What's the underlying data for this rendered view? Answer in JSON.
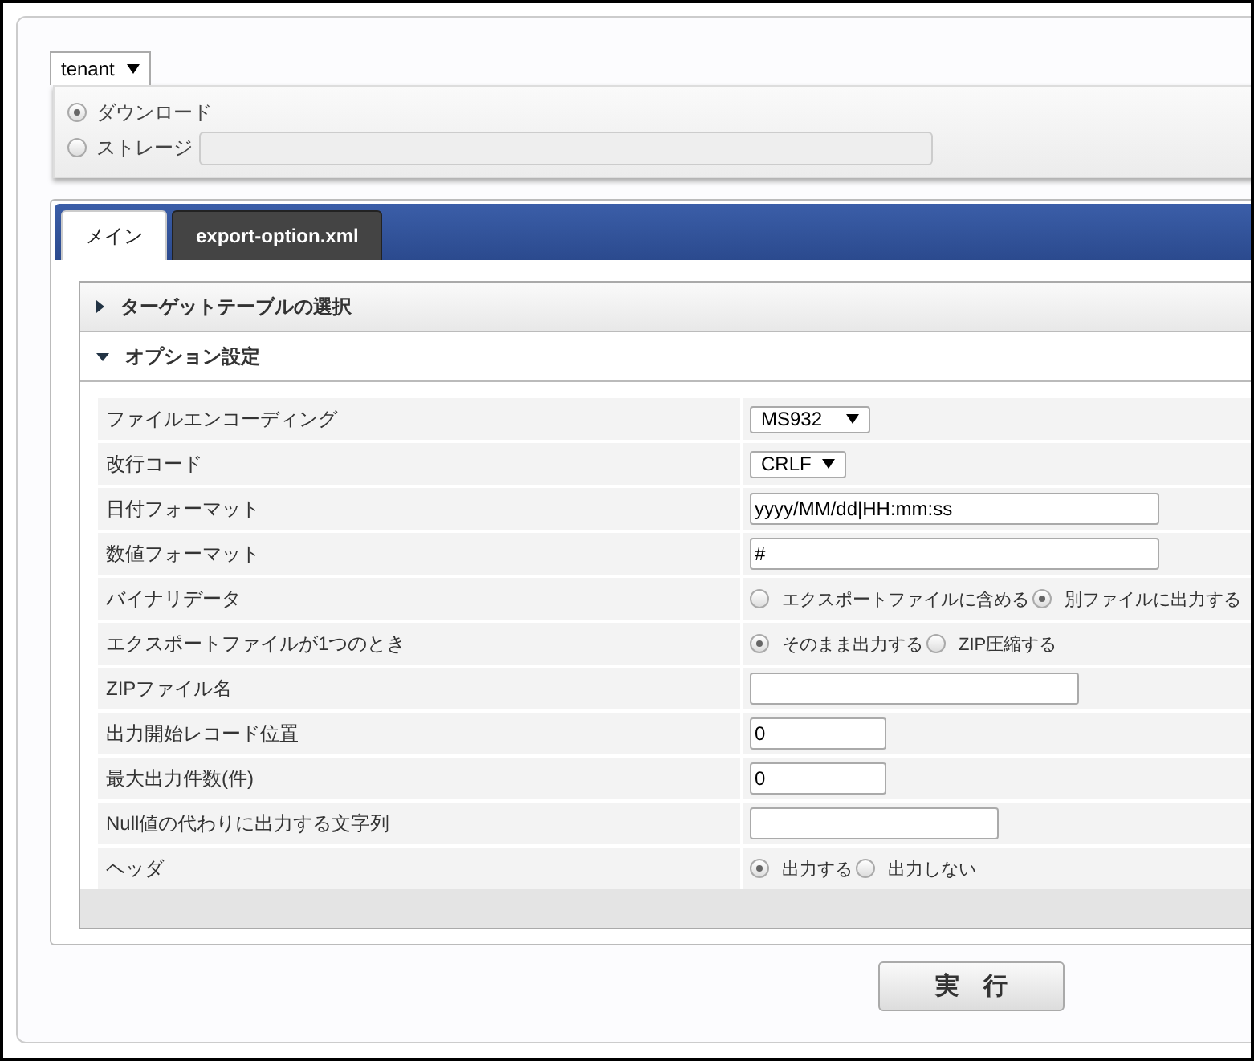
{
  "tenant_select": {
    "value": "tenant"
  },
  "destination": [
    {
      "label": "ダウンロード",
      "selected": true,
      "kind": "radio"
    },
    {
      "label": "ストレージ",
      "selected": false,
      "kind": "radio_field"
    }
  ],
  "tabs": [
    {
      "label": "メイン",
      "selected": true
    },
    {
      "label": "export-option.xml",
      "selected": false
    }
  ],
  "sections": [
    {
      "title": "ターゲットテーブルの選択",
      "expanded": false
    },
    {
      "title": "オプション設定",
      "expanded": true
    }
  ],
  "options": [
    {
      "label": "ファイルエンコーディング",
      "kind": "select",
      "value": "MS932"
    },
    {
      "label": "改行コード",
      "kind": "select",
      "value": "CRLF"
    },
    {
      "label": "日付フォーマット",
      "kind": "text",
      "value": "yyyy/MM/dd|HH:mm:ss"
    },
    {
      "label": "数値フォーマット",
      "kind": "text",
      "value": "#"
    },
    {
      "label": "バイナリデータ",
      "kind": "radio",
      "choices": [
        {
          "label": "エクスポートファイルに含める",
          "selected": false
        },
        {
          "label": "別ファイルに出力する",
          "selected": true
        }
      ]
    },
    {
      "label": "エクスポートファイルが1つのとき",
      "kind": "radio",
      "choices": [
        {
          "label": "そのまま出力する",
          "selected": true
        },
        {
          "label": "ZIP圧縮する",
          "selected": false
        }
      ]
    },
    {
      "label": "ZIPファイル名",
      "kind": "text"
    },
    {
      "label": "出力開始レコード位置",
      "kind": "text",
      "value": "0"
    },
    {
      "label": "最大出力件数(件)",
      "kind": "text",
      "value": "0"
    },
    {
      "label": "Null値の代わりに出力する文字列",
      "kind": "text"
    },
    {
      "label": "ヘッダ",
      "kind": "radio",
      "choices": [
        {
          "label": "出力する",
          "selected": true
        },
        {
          "label": "出力しない",
          "selected": false
        }
      ]
    }
  ],
  "run_button": {
    "label": "実　行"
  }
}
